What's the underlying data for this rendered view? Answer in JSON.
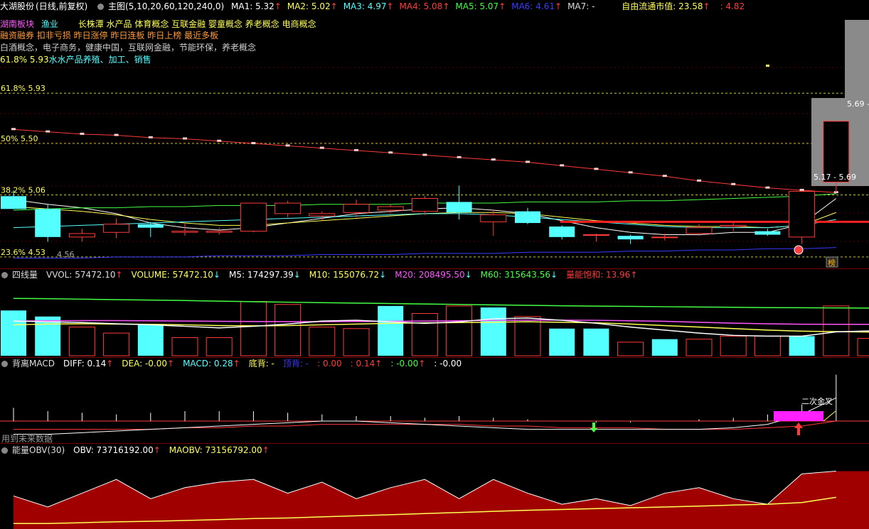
{
  "colors": {
    "up": "#ff3a3a",
    "down": "#54ffff",
    "bg": "#000000",
    "grid": "#7a0000"
  },
  "header": {
    "title": "大湖股份",
    "mode": "(日线,前复权)",
    "main_label": "主图(5,10,20,60,120,240,0)",
    "ma": [
      {
        "label": "MA1: 5.32",
        "arrow": "↑",
        "color": "#ffffff"
      },
      {
        "label": "MA2: 5.02",
        "arrow": "↑",
        "color": "#ffff55"
      },
      {
        "label": "MA3: 4.97",
        "arrow": "↑",
        "color": "#54ffff"
      },
      {
        "label": "MA4: 5.08",
        "arrow": "↑",
        "color": "#ff3a3a"
      },
      {
        "label": "MA5: 5.07",
        "arrow": "↑",
        "color": "#44ff44"
      },
      {
        "label": "MA6: 4.61",
        "arrow": "↑",
        "color": "#3a3aff"
      },
      {
        "label": "MA7: -",
        "arrow": "",
        "color": "#dddddd"
      }
    ],
    "float_cap": "自由流通市值: 23.58",
    "float_cap_arrow": "↑",
    "float_cap_extra": ": 4.82"
  },
  "info": {
    "sector_label": "湖南板块",
    "sector_value": "渔业",
    "concepts_line1": "长株潭 水产品 体育概念 互联金融 婴童概念 养老概念 电商概念",
    "tags_line": "融资融券 扣非亏损 昨日涨停 昨日连板 昨日上榜 最近多板",
    "concepts_line2": "白酒概念，电子商务，健康中国，互联网金融，节能环保，养老概念",
    "business_line": "水水产品养殖、加工、销售",
    "level_top": "61.8% 5.93"
  },
  "chart_data": [
    {
      "type": "candlestick",
      "name": "main",
      "fib_levels": [
        {
          "label": "61.8% 5.93",
          "value": 5.93
        },
        {
          "label": "50% 5.50",
          "value": 5.5
        },
        {
          "label": "38.2% 5.06",
          "value": 5.06
        },
        {
          "label": "23.6% 4.53",
          "value": 4.53
        }
      ],
      "price_label_low": "4.56",
      "price_label_cur": "5.17 - 5.69",
      "price_label_high": "5.69 -",
      "badge": "榜",
      "ylim": [
        4.45,
        6.15
      ],
      "candles": [
        {
          "o": 5.05,
          "h": 5.1,
          "l": 4.94,
          "c": 4.94
        },
        {
          "o": 4.94,
          "h": 4.98,
          "l": 4.66,
          "c": 4.7
        },
        {
          "o": 4.7,
          "h": 4.77,
          "l": 4.66,
          "c": 4.73
        },
        {
          "o": 4.74,
          "h": 4.86,
          "l": 4.69,
          "c": 4.81
        },
        {
          "o": 4.81,
          "h": 4.83,
          "l": 4.7,
          "c": 4.78
        },
        {
          "o": 4.74,
          "h": 4.82,
          "l": 4.71,
          "c": 4.75
        },
        {
          "o": 4.74,
          "h": 4.78,
          "l": 4.72,
          "c": 4.75
        },
        {
          "o": 4.75,
          "h": 4.98,
          "l": 4.74,
          "c": 4.99
        },
        {
          "o": 4.9,
          "h": 5.01,
          "l": 4.87,
          "c": 4.99
        },
        {
          "o": 4.88,
          "h": 4.92,
          "l": 4.84,
          "c": 4.9
        },
        {
          "o": 4.91,
          "h": 5.02,
          "l": 4.87,
          "c": 4.98
        },
        {
          "o": 4.93,
          "h": 4.98,
          "l": 4.9,
          "c": 4.96
        },
        {
          "o": 4.92,
          "h": 5.05,
          "l": 4.89,
          "c": 5.03
        },
        {
          "o": 5.0,
          "h": 5.14,
          "l": 4.85,
          "c": 4.91
        },
        {
          "o": 4.83,
          "h": 4.93,
          "l": 4.71,
          "c": 4.89
        },
        {
          "o": 4.92,
          "h": 4.95,
          "l": 4.81,
          "c": 4.82
        },
        {
          "o": 4.79,
          "h": 4.8,
          "l": 4.68,
          "c": 4.7
        },
        {
          "o": 4.72,
          "h": 4.73,
          "l": 4.66,
          "c": 4.72
        },
        {
          "o": 4.71,
          "h": 4.72,
          "l": 4.64,
          "c": 4.68
        },
        {
          "o": 4.7,
          "h": 4.73,
          "l": 4.67,
          "c": 4.7
        },
        {
          "o": 4.73,
          "h": 4.81,
          "l": 4.71,
          "c": 4.78
        },
        {
          "o": 4.79,
          "h": 4.82,
          "l": 4.75,
          "c": 4.8
        },
        {
          "o": 4.75,
          "h": 4.77,
          "l": 4.71,
          "c": 4.72
        },
        {
          "o": 4.7,
          "h": 5.1,
          "l": 4.64,
          "c": 5.09
        },
        {
          "o": 5.17,
          "h": 5.69,
          "l": 5.08,
          "c": 5.69
        }
      ],
      "ma_lines": [
        {
          "name": "MA1",
          "color": "#ffffff",
          "values": [
            5.02,
            4.98,
            4.95,
            4.9,
            4.82,
            4.78,
            4.76,
            4.78,
            4.82,
            4.86,
            4.9,
            4.92,
            4.94,
            4.95,
            4.93,
            4.9,
            4.84,
            4.78,
            4.74,
            4.72,
            4.72,
            4.74,
            4.74,
            4.81,
            5.03
          ]
        },
        {
          "name": "MA2",
          "color": "#ffff55",
          "values": [
            4.96,
            4.94,
            4.92,
            4.89,
            4.85,
            4.82,
            4.8,
            4.8,
            4.82,
            4.84,
            4.86,
            4.88,
            4.9,
            4.91,
            4.91,
            4.9,
            4.87,
            4.84,
            4.82,
            4.8,
            4.79,
            4.79,
            4.78,
            4.8,
            4.91
          ]
        },
        {
          "name": "MA3",
          "color": "#54ffff",
          "values": [
            4.78,
            4.79,
            4.8,
            4.81,
            4.82,
            4.83,
            4.84,
            4.85,
            4.86,
            4.87,
            4.88,
            4.89,
            4.9,
            4.9,
            4.89,
            4.87,
            4.85,
            4.83,
            4.81,
            4.79,
            4.78,
            4.78,
            4.78,
            4.8,
            4.85
          ]
        },
        {
          "name": "MA4",
          "color": "#ff3a3a",
          "values": [
            5.62,
            5.6,
            5.58,
            5.57,
            5.55,
            5.54,
            5.52,
            5.5,
            5.48,
            5.46,
            5.44,
            5.42,
            5.4,
            5.38,
            5.36,
            5.34,
            5.31,
            5.28,
            5.25,
            5.22,
            5.18,
            5.15,
            5.12,
            5.1,
            5.08
          ]
        },
        {
          "name": "MA5",
          "color": "#44ff44",
          "values": [
            4.93,
            4.94,
            4.95,
            4.95,
            4.96,
            4.96,
            4.97,
            4.97,
            4.97,
            4.98,
            4.98,
            4.98,
            4.99,
            4.99,
            4.99,
            5.0,
            5.0,
            5.0,
            5.01,
            5.01,
            5.02,
            5.03,
            5.04,
            5.05,
            5.07
          ]
        },
        {
          "name": "MA6",
          "color": "#3a3aff",
          "values": [
            4.52,
            4.52,
            4.52,
            4.53,
            4.53,
            4.53,
            4.54,
            4.54,
            4.54,
            4.55,
            4.55,
            4.55,
            4.56,
            4.56,
            4.56,
            4.57,
            4.57,
            4.57,
            4.58,
            4.58,
            4.59,
            4.59,
            4.6,
            4.6,
            4.61
          ]
        }
      ],
      "support_line": 4.83
    },
    {
      "type": "bar",
      "name": "四线量",
      "legend": [
        {
          "label": "四线量",
          "color": "#dddddd"
        },
        {
          "label": "VVOL: 57472.10",
          "arrow": "↑",
          "color": "#dddddd"
        },
        {
          "label": "VOLUME: 57472.10",
          "arrow": "↓",
          "color": "#ffff55"
        },
        {
          "label": "M5: 174297.39",
          "arrow": "↓",
          "color": "#ffffff"
        },
        {
          "label": "M10: 155076.72",
          "arrow": "↓",
          "color": "#ffff55"
        },
        {
          "label": "M20: 208495.50",
          "arrow": "↓",
          "color": "#ff55ff"
        },
        {
          "label": "M60: 315643.56",
          "arrow": "↓",
          "color": "#44ff44"
        },
        {
          "label": "量能饱和: 13.96",
          "arrow": "↑",
          "color": "#ff3a3a"
        }
      ],
      "ylim": [
        0,
        480000
      ],
      "values": [
        300000,
        260000,
        190000,
        150000,
        210000,
        120000,
        120000,
        360000,
        340000,
        190000,
        180000,
        330000,
        280000,
        330000,
        320000,
        260000,
        180000,
        180000,
        90000,
        110000,
        110000,
        130000,
        130000,
        130000,
        330000,
        115000,
        60000
      ],
      "up": [
        false,
        false,
        true,
        true,
        false,
        true,
        true,
        true,
        true,
        true,
        true,
        false,
        true,
        true,
        false,
        true,
        false,
        false,
        true,
        false,
        true,
        true,
        true,
        false,
        true,
        true,
        true
      ],
      "M5": [
        230000,
        225000,
        220000,
        212000,
        205000,
        195000,
        185000,
        195000,
        210000,
        230000,
        235000,
        225000,
        215000,
        225000,
        245000,
        250000,
        235000,
        215000,
        190000,
        170000,
        150000,
        135000,
        130000,
        130000,
        158000,
        165000,
        174000
      ],
      "M10": [
        205000,
        210000,
        212000,
        210000,
        208000,
        205000,
        200000,
        198000,
        200000,
        205000,
        210000,
        215000,
        218000,
        220000,
        222000,
        225000,
        222000,
        218000,
        210000,
        200000,
        190000,
        180000,
        170000,
        163000,
        160000,
        157000,
        155000
      ],
      "M20": [
        230000,
        232000,
        233000,
        233000,
        232000,
        230000,
        228000,
        227000,
        226000,
        226000,
        227000,
        228000,
        230000,
        232000,
        234000,
        236000,
        236000,
        235000,
        232000,
        228000,
        222000,
        216000,
        212000,
        209000,
        208000,
        208000,
        208500
      ],
      "M60": [
        380000,
        378000,
        375000,
        372000,
        369000,
        366000,
        362000,
        358000,
        355000,
        352000,
        349000,
        346000,
        343000,
        340000,
        337000,
        334000,
        331000,
        329000,
        327000,
        325000,
        323000,
        321000,
        319000,
        318000,
        317000,
        316000,
        315600
      ]
    },
    {
      "type": "line",
      "name": "背离MACD",
      "legend": [
        {
          "label": "背离MACD",
          "color": "#dddddd"
        },
        {
          "label": "DIFF: 0.14",
          "arrow": "↑",
          "color": "#ffffff"
        },
        {
          "label": "DEA: -0.00",
          "arrow": "↑",
          "color": "#ffff55"
        },
        {
          "label": "MACD: 0.28",
          "arrow": "↑",
          "color": "#54ffff"
        },
        {
          "label": "底背: -",
          "arrow": "",
          "color": "#ffff55"
        },
        {
          "label": "顶背: -",
          "arrow": "",
          "color": "#3a3aff"
        },
        {
          "label": ": 0.00",
          "arrow": "",
          "color": "#ff3a3a"
        },
        {
          "label": ": 0.14",
          "arrow": "↑",
          "color": "#ff3a3a"
        },
        {
          "label": ": -0.00",
          "arrow": "↑",
          "color": "#44ff44"
        },
        {
          "label": ": -0.00",
          "arrow": "",
          "color": "#ffffff"
        }
      ],
      "annotation_cross": "二次金叉",
      "annotation_future": "用到未来数据",
      "ylim": [
        -0.12,
        0.3
      ],
      "macd": [
        0.08,
        0.06,
        0.05,
        0.04,
        0.05,
        0.06,
        0.06,
        0.06,
        0.05,
        0.04,
        0.03,
        0.03,
        0.02,
        0.03,
        0.02,
        0.01,
        0.0,
        -0.01,
        -0.01,
        0.0,
        0.01,
        0.02,
        0.04,
        0.1,
        0.28
      ],
      "diff": [
        -0.08,
        -0.08,
        -0.07,
        -0.06,
        -0.05,
        -0.04,
        -0.03,
        -0.02,
        -0.01,
        0.0,
        0.0,
        -0.01,
        -0.02,
        -0.03,
        -0.04,
        -0.05,
        -0.05,
        -0.05,
        -0.05,
        -0.05,
        -0.05,
        -0.04,
        -0.02,
        0.04,
        0.14
      ],
      "dea": [
        -0.05,
        -0.05,
        -0.05,
        -0.05,
        -0.05,
        -0.04,
        -0.04,
        -0.03,
        -0.03,
        -0.02,
        -0.02,
        -0.02,
        -0.02,
        -0.02,
        -0.03,
        -0.03,
        -0.04,
        -0.04,
        -0.04,
        -0.05,
        -0.05,
        -0.05,
        -0.04,
        -0.03,
        0.0
      ]
    },
    {
      "type": "area",
      "name": "能量OBV",
      "legend": [
        {
          "label": "能量OBV(30)",
          "color": "#dddddd"
        },
        {
          "label": "OBV: 73716192.00",
          "arrow": "↑",
          "color": "#ffffff"
        },
        {
          "label": "MAOBV: 73156792.00",
          "arrow": "↑",
          "color": "#ffff55"
        }
      ],
      "ylim": [
        72000000,
        74500000
      ],
      "obv": [
        73200000,
        72800000,
        73300000,
        73800000,
        73100000,
        73500000,
        73700000,
        73800000,
        73300000,
        73700000,
        73100000,
        73500000,
        73800000,
        73100000,
        73800000,
        73300000,
        72900000,
        73100000,
        72850000,
        73300000,
        73500000,
        73100000,
        72900000,
        74000000,
        74100000
      ],
      "maobv": [
        72200000,
        72200000,
        72230000,
        72260000,
        72280000,
        72310000,
        72340000,
        72380000,
        72400000,
        72440000,
        72480000,
        72520000,
        72560000,
        72600000,
        72640000,
        72680000,
        72710000,
        72740000,
        72770000,
        72800000,
        72830000,
        72870000,
        72900000,
        72960000,
        73150000
      ]
    }
  ]
}
